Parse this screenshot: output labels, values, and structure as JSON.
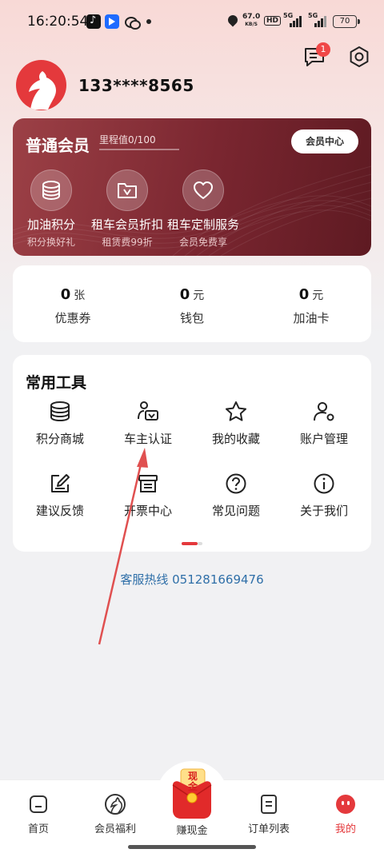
{
  "status_bar": {
    "time": "16:20:54",
    "net_speed_value": "67.0",
    "net_speed_unit": "KB/S",
    "hd_label": "HD",
    "signal_1": "5G",
    "signal_2": "5G",
    "battery": "70"
  },
  "header": {
    "message_badge": "1",
    "icons": [
      "message-icon",
      "settings-icon"
    ]
  },
  "profile": {
    "phone": "133****8565"
  },
  "member_card": {
    "level": "普通会员",
    "mileage_label": "里程值0/100",
    "mileage_progress": 0,
    "center_button": "会员中心",
    "benefits": [
      {
        "title": "加油积分",
        "subtitle": "积分换好礼",
        "icon": "coins-icon"
      },
      {
        "title": "租车会员折扣",
        "subtitle": "租赁费99折",
        "icon": "discount-folder-icon"
      },
      {
        "title": "租车定制服务",
        "subtitle": "会员免费享",
        "icon": "heart-icon"
      }
    ]
  },
  "wallet": [
    {
      "value": "0",
      "unit": "张",
      "label": "优惠券"
    },
    {
      "value": "0",
      "unit": "元",
      "label": "钱包"
    },
    {
      "value": "0",
      "unit": "元",
      "label": "加油卡"
    }
  ],
  "tools": {
    "title": "常用工具",
    "items": [
      {
        "label": "积分商城",
        "icon": "coins-stack-icon"
      },
      {
        "label": "车主认证",
        "icon": "owner-verify-icon"
      },
      {
        "label": "我的收藏",
        "icon": "star-icon"
      },
      {
        "label": "账户管理",
        "icon": "user-settings-icon"
      },
      {
        "label": "建议反馈",
        "icon": "edit-feedback-icon"
      },
      {
        "label": "开票中心",
        "icon": "invoice-icon"
      },
      {
        "label": "常见问题",
        "icon": "question-icon"
      },
      {
        "label": "关于我们",
        "icon": "info-icon"
      }
    ]
  },
  "hotline": "客服热线 051281669476",
  "bottom_nav": {
    "items": [
      {
        "label": "首页",
        "icon": "home-icon"
      },
      {
        "label": "会员福利",
        "icon": "member-benefit-icon"
      },
      {
        "label": "赚现金",
        "icon": "cash-redpacket-icon",
        "badge_text": "现金"
      },
      {
        "label": "订单列表",
        "icon": "order-list-icon"
      },
      {
        "label": "我的",
        "icon": "mine-face-icon"
      }
    ],
    "active_index": 4
  },
  "colors": {
    "accent": "#e4393c",
    "member_card": "#7a2630",
    "hotline": "#2f6fa8",
    "annotation_arrow": "#e05050"
  }
}
